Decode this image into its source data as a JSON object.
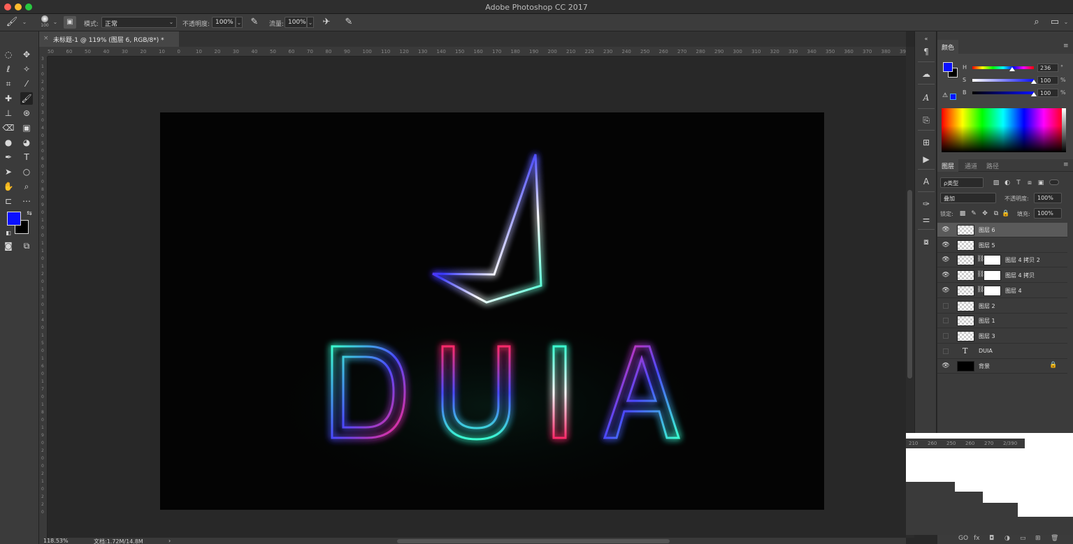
{
  "window": {
    "title": "Adobe Photoshop CC 2017"
  },
  "options_bar": {
    "brush_size": "100",
    "mode_label": "模式:",
    "mode_value": "正常",
    "opacity_label": "不透明度:",
    "opacity_value": "100%",
    "flow_label": "流量:",
    "flow_value": "100%"
  },
  "document_tab": {
    "title": "未标题-1 @ 119% (图层 6, RGB/8*) *",
    "close": "×"
  },
  "ruler_h": [
    "50",
    "60",
    "50",
    "40",
    "30",
    "20",
    "10",
    "0",
    "10",
    "20",
    "30",
    "40",
    "50",
    "60",
    "70",
    "80",
    "90",
    "100",
    "110",
    "120",
    "130",
    "140",
    "150",
    "160",
    "170",
    "180",
    "190",
    "200",
    "210",
    "220",
    "230",
    "240",
    "250",
    "260",
    "270",
    "280",
    "290",
    "300",
    "310",
    "320",
    "330",
    "340",
    "350",
    "360",
    "370",
    "380",
    "390"
  ],
  "ruler_v": [
    "3",
    "1",
    "0",
    "2",
    "0",
    "2",
    "0",
    "3",
    "0",
    "4",
    "0",
    "5",
    "0",
    "6",
    "0",
    "7",
    "0",
    "8",
    "0",
    "9",
    "0",
    "1",
    "0",
    "0",
    "1",
    "1",
    "0",
    "1",
    "2",
    "0",
    "1",
    "3",
    "0",
    "1",
    "4",
    "0",
    "1",
    "5",
    "0",
    "1",
    "6",
    "0",
    "1",
    "7",
    "0",
    "1",
    "8",
    "0",
    "1",
    "9",
    "0",
    "2",
    "0",
    "0",
    "2",
    "1",
    "0",
    "2",
    "2",
    "0"
  ],
  "canvas": {
    "letters": "DUIA"
  },
  "status_bar": {
    "zoom": "118.53%",
    "doc_size": "文档:1.72M/14.8M",
    "arrow": "›"
  },
  "color_panel": {
    "tab": "颜色",
    "h": {
      "key": "H",
      "value": "236",
      "unit": "°"
    },
    "s": {
      "key": "S",
      "value": "100",
      "unit": "%"
    },
    "b": {
      "key": "B",
      "value": "100",
      "unit": "%"
    }
  },
  "layers_panel": {
    "tabs": [
      "图层",
      "通道",
      "路径"
    ],
    "filter_type": "ρ类型",
    "blend_mode": "叠加",
    "opacity_label": "不透明度:",
    "opacity_value": "100%",
    "lock_label": "锁定:",
    "fill_label": "填充:",
    "fill_value": "100%",
    "layers": [
      {
        "name": "图层 6",
        "visible": true,
        "selected": true,
        "mask": false
      },
      {
        "name": "图层 5",
        "visible": true,
        "selected": false,
        "mask": false
      },
      {
        "name": "图层 4 拷贝 2",
        "visible": true,
        "selected": false,
        "mask": true
      },
      {
        "name": "图层 4 拷贝",
        "visible": true,
        "selected": false,
        "mask": true
      },
      {
        "name": "图层 4",
        "visible": true,
        "selected": false,
        "mask": true
      },
      {
        "name": "图层 2",
        "visible": false,
        "selected": false,
        "mask": false
      },
      {
        "name": "图层 1",
        "visible": false,
        "selected": false,
        "mask": false
      },
      {
        "name": "图层 3",
        "visible": false,
        "selected": false,
        "mask": false
      },
      {
        "name": "DUIA",
        "visible": false,
        "selected": false,
        "mask": false,
        "text": true
      },
      {
        "name": "背景",
        "visible": true,
        "selected": false,
        "mask": false,
        "locked": true
      }
    ],
    "bottom_icons": [
      "GO",
      "fx",
      "◘",
      "◑",
      "▭",
      "⊞",
      "🗑"
    ]
  },
  "ghost_ruler": [
    "210",
    "260",
    "250",
    "260",
    "270",
    "2/390"
  ],
  "colors": {
    "foreground": "#0a10ff",
    "background": "#000000",
    "accent_cyan": "#3affd0",
    "accent_magenta": "#ff2a8a",
    "accent_blue": "#3a3aff"
  }
}
